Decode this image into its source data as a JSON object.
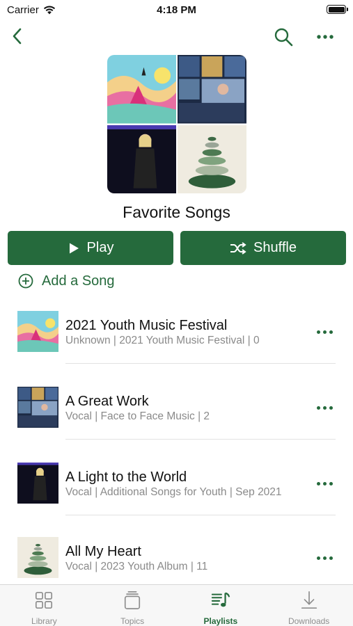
{
  "status_bar": {
    "carrier": "Carrier",
    "time": "4:18 PM"
  },
  "nav": {
    "back_icon": "chevron-left-icon",
    "search_icon": "search-icon",
    "more_icon": "ellipsis-icon"
  },
  "playlist": {
    "title": "Favorite Songs",
    "play_label": "Play",
    "shuffle_label": "Shuffle",
    "add_song_label": "Add a Song"
  },
  "songs": [
    {
      "title": "2021 Youth Music Festival",
      "subtitle": "Unknown | 2021 Youth Music Festival | 0"
    },
    {
      "title": "A Great Work",
      "subtitle": "Vocal | Face to Face Music | 2"
    },
    {
      "title": "A Light to the World",
      "subtitle": "Vocal | Additional Songs for Youth | Sep 2021"
    },
    {
      "title": "All My Heart",
      "subtitle": "Vocal | 2023 Youth Album | 11"
    }
  ],
  "tabs": [
    {
      "label": "Library",
      "icon": "grid-icon"
    },
    {
      "label": "Topics",
      "icon": "stack-icon"
    },
    {
      "label": "Playlists",
      "icon": "playlist-icon",
      "active": true
    },
    {
      "label": "Downloads",
      "icon": "download-icon"
    }
  ],
  "colors": {
    "accent": "#256a3c",
    "tab_inactive": "#8e8e8e",
    "subtitle": "#8a8a8a"
  }
}
